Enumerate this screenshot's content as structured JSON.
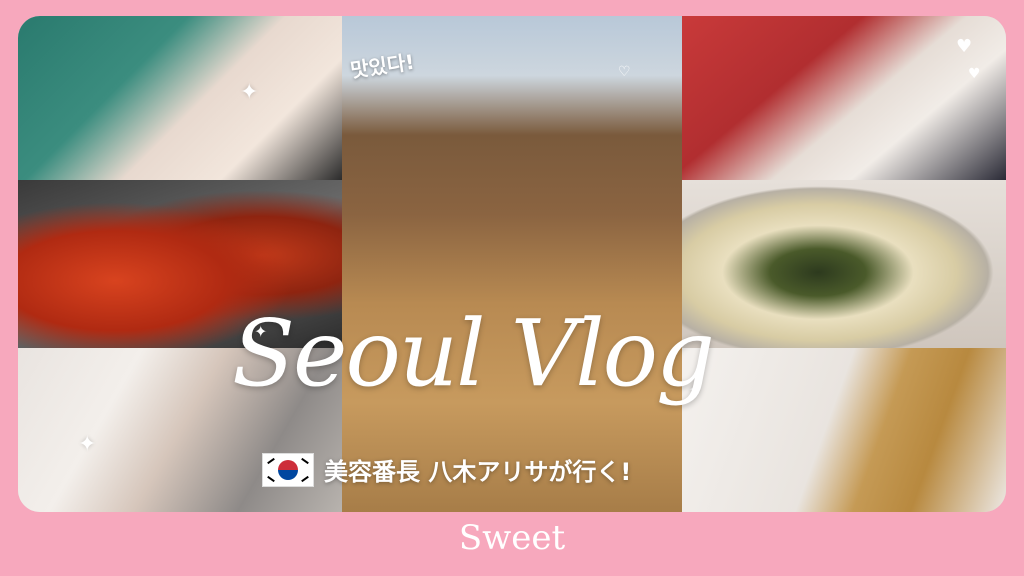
{
  "title": "Seoul Vlog",
  "subtitle": "美容番長 八木アリサが行く!",
  "korean_caption": "맛있다!",
  "brand": "Sweet",
  "flag_icon": "south-korea-flag-icon",
  "colors": {
    "background": "#f7a8bd",
    "text": "#ffffff"
  }
}
